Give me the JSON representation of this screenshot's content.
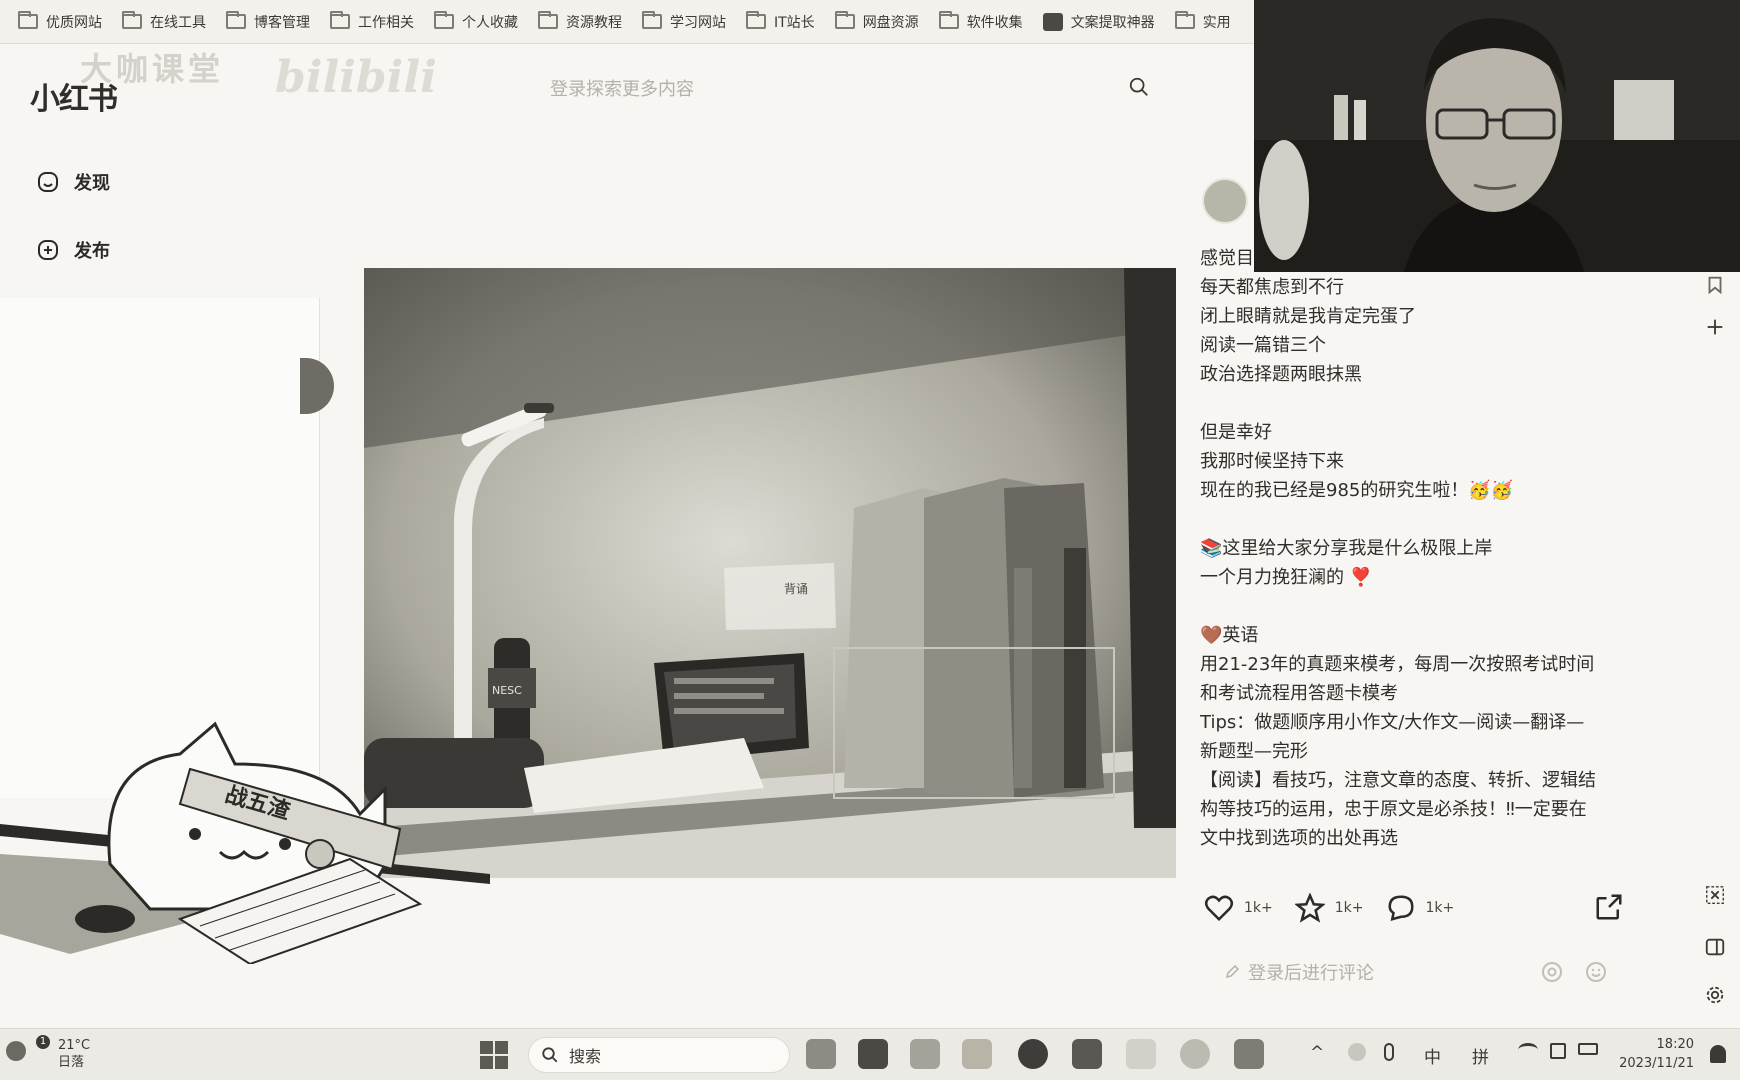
{
  "bookmarks": [
    {
      "label": "优质网站",
      "icon": "folder-icon"
    },
    {
      "label": "在线工具",
      "icon": "folder-icon"
    },
    {
      "label": "博客管理",
      "icon": "folder-icon"
    },
    {
      "label": "工作相关",
      "icon": "folder-icon"
    },
    {
      "label": "个人收藏",
      "icon": "folder-icon"
    },
    {
      "label": "资源教程",
      "icon": "folder-icon"
    },
    {
      "label": "学习网站",
      "icon": "folder-icon"
    },
    {
      "label": "IT站长",
      "icon": "folder-icon"
    },
    {
      "label": "网盘资源",
      "icon": "folder-icon"
    },
    {
      "label": "软件收集",
      "icon": "folder-icon"
    },
    {
      "label": "文案提取神器",
      "icon": "app-icon"
    },
    {
      "label": "实用",
      "icon": "folder-icon"
    }
  ],
  "header": {
    "logo": "小红书",
    "watermark": "大咖课堂",
    "watermark2": "bilibili",
    "search_placeholder": "登录探索更多内容"
  },
  "nav": {
    "discover": "发现",
    "publish": "发布"
  },
  "note": {
    "lines": [
      "感觉目",
      "每天都焦虑到不行",
      "闭上眼睛就是我肯定完蛋了",
      "阅读一篇错三个",
      "政治选择题两眼抹黑",
      "",
      "但是幸好",
      "我那时候坚持下来",
      "现在的我已经是985的研究生啦！🥳🥳",
      "",
      "📚这里给大家分享我是什么极限上岸",
      "一个月力挽狂澜的 ❣️",
      "",
      "🤎英语",
      "用21-23年的真题来模考，每周一次按照考试时间",
      "和考试流程用答题卡模考",
      "Tips：做题顺序用小作文/大作文—阅读—翻译—",
      "新题型—完形",
      "【阅读】看技巧，注意文章的态度、转折、逻辑结",
      "构等技巧的运用，忠于原文是必杀技！‼一定要在",
      "文中找到选项的出处再选"
    ],
    "likes": "1k+",
    "collects": "1k+",
    "comments": "1k+",
    "comment_placeholder": "登录后进行评论"
  },
  "photo": {
    "bottle_label": "NESC",
    "sticky_note": "背诵",
    "cat_banner": "战五渣"
  },
  "taskbar": {
    "temperature": "21°C",
    "weather_text": "日落",
    "search_label": "搜索",
    "ime_lang": "中",
    "ime_mode": "拼",
    "time": "18:20",
    "date": "2023/11/21",
    "weather_badge": "1"
  }
}
